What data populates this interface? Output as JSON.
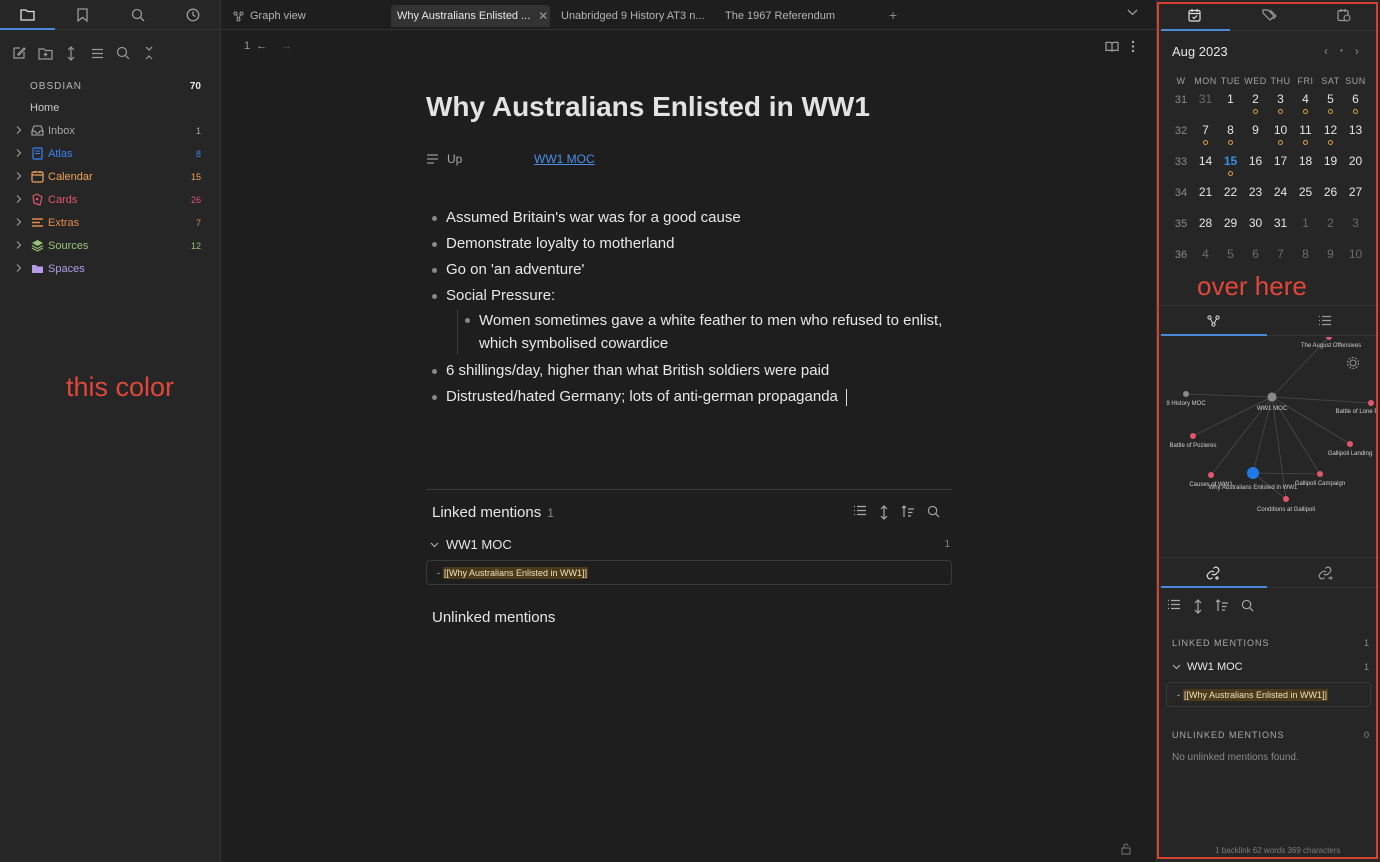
{
  "left_sidebar": {
    "vault_name": "OBSDIAN",
    "vault_count": "70",
    "home_label": "Home",
    "folders": [
      {
        "label": "Inbox",
        "count": "1",
        "color": "#a8a8a8",
        "icon": "inbox-icon"
      },
      {
        "label": "Atlas",
        "count": "8",
        "color": "#3b82f6",
        "icon": "atlas-icon"
      },
      {
        "label": "Calendar",
        "count": "15",
        "color": "#f0a35a",
        "icon": "calendar-icon"
      },
      {
        "label": "Cards",
        "count": "26",
        "color": "#e2566b",
        "icon": "cards-icon"
      },
      {
        "label": "Extras",
        "count": "7",
        "color": "#e58a4d",
        "icon": "extras-icon"
      },
      {
        "label": "Sources",
        "count": "12",
        "color": "#98c379",
        "icon": "sources-icon"
      },
      {
        "label": "Spaces",
        "count": "",
        "color": "#b69be6",
        "icon": "spaces-icon"
      }
    ],
    "annotation": "this color"
  },
  "tabs": {
    "graph": "Graph view",
    "active": "Why Australians Enlisted ...",
    "tab3": "Unabridged 9 History AT3 n...",
    "tab4": "The 1967 Referendum",
    "plus": "+"
  },
  "editor": {
    "nav_count": "1",
    "title": "Why Australians Enlisted in WW1",
    "property_label": "Up",
    "property_value": "WW1 MOC",
    "bullets": [
      "Assumed Britain's war was for a good cause",
      "Demonstrate loyalty to motherland",
      "Go on 'an adventure'",
      "Social Pressure:",
      "6 shillings/day, higher than what British soldiers were paid",
      "Distrusted/hated Germany; lots of anti-german propaganda"
    ],
    "sub_bullet": "Women sometimes gave a white feather to men who refused to enlist, which symbolised cowardice",
    "linked_title": "Linked mentions",
    "linked_count": "1",
    "linked_group": "WW1 MOC",
    "linked_group_count": "1",
    "snippet_prefix": "-",
    "snippet_link": "[[Why Australians Enlisted in WW1]]",
    "unlinked_title": "Unlinked mentions"
  },
  "calendar": {
    "month": "Aug 2023",
    "dow": [
      "W",
      "MON",
      "TUE",
      "WED",
      "THU",
      "FRI",
      "SAT",
      "SUN"
    ],
    "weeks": [
      {
        "wk": "31",
        "days": [
          {
            "d": "31",
            "dim": true
          },
          {
            "d": "1"
          },
          {
            "d": "2",
            "dot": true
          },
          {
            "d": "3",
            "dot": true
          },
          {
            "d": "4",
            "dot": true
          },
          {
            "d": "5",
            "dot": true
          },
          {
            "d": "6",
            "dot": true
          }
        ]
      },
      {
        "wk": "32",
        "days": [
          {
            "d": "7",
            "dot": true
          },
          {
            "d": "8",
            "dot": true
          },
          {
            "d": "9"
          },
          {
            "d": "10",
            "dot": true
          },
          {
            "d": "11",
            "dot": true
          },
          {
            "d": "12",
            "dot": true
          },
          {
            "d": "13"
          }
        ]
      },
      {
        "wk": "33",
        "days": [
          {
            "d": "14"
          },
          {
            "d": "15",
            "today": true,
            "dot": true
          },
          {
            "d": "16"
          },
          {
            "d": "17"
          },
          {
            "d": "18"
          },
          {
            "d": "19"
          },
          {
            "d": "20"
          }
        ]
      },
      {
        "wk": "34",
        "days": [
          {
            "d": "21"
          },
          {
            "d": "22"
          },
          {
            "d": "23"
          },
          {
            "d": "24"
          },
          {
            "d": "25"
          },
          {
            "d": "26"
          },
          {
            "d": "27"
          }
        ]
      },
      {
        "wk": "35",
        "days": [
          {
            "d": "28"
          },
          {
            "d": "29"
          },
          {
            "d": "30"
          },
          {
            "d": "31"
          },
          {
            "d": "1",
            "dim": true
          },
          {
            "d": "2",
            "dim": true
          },
          {
            "d": "3",
            "dim": true
          }
        ]
      },
      {
        "wk": "36",
        "days": [
          {
            "d": "4",
            "dim": true
          },
          {
            "d": "5",
            "dim": true
          },
          {
            "d": "6",
            "dim": true
          },
          {
            "d": "7",
            "dim": true
          },
          {
            "d": "8",
            "dim": true
          },
          {
            "d": "9",
            "dim": true
          },
          {
            "d": "10",
            "dim": true
          }
        ]
      }
    ],
    "annotation": "over here"
  },
  "graph": {
    "nodes": {
      "august": "The August Offensives",
      "history": "9 History MOC",
      "ww1": "WW1 MOC",
      "lone": "Battle of Lone P",
      "pozieres": "Battle of Pozieres",
      "gallipoli_landing": "Gallipoli Landing",
      "causes": "Causes of WW1",
      "why": "Why Australians Enlisted in WW1",
      "campaign": "Gallipoli Campaign",
      "conditions": "Conditions at Gallipoli"
    }
  },
  "backlinks": {
    "linked_header": "LINKED MENTIONS",
    "linked_count": "1",
    "group": "WW1 MOC",
    "group_count": "1",
    "snippet_prefix": "-",
    "snippet_link": "[[Why Australians Enlisted in WW1]]",
    "unlinked_header": "UNLINKED MENTIONS",
    "unlinked_count": "0",
    "empty": "No unlinked mentions found."
  },
  "status": {
    "text": "1 backlink   62 words 369 characters"
  },
  "colors": {
    "accent": "#4a88d8",
    "annotation": "#e0473a",
    "graph_node": "#e2566b",
    "graph_active": "#1f7ae6"
  }
}
